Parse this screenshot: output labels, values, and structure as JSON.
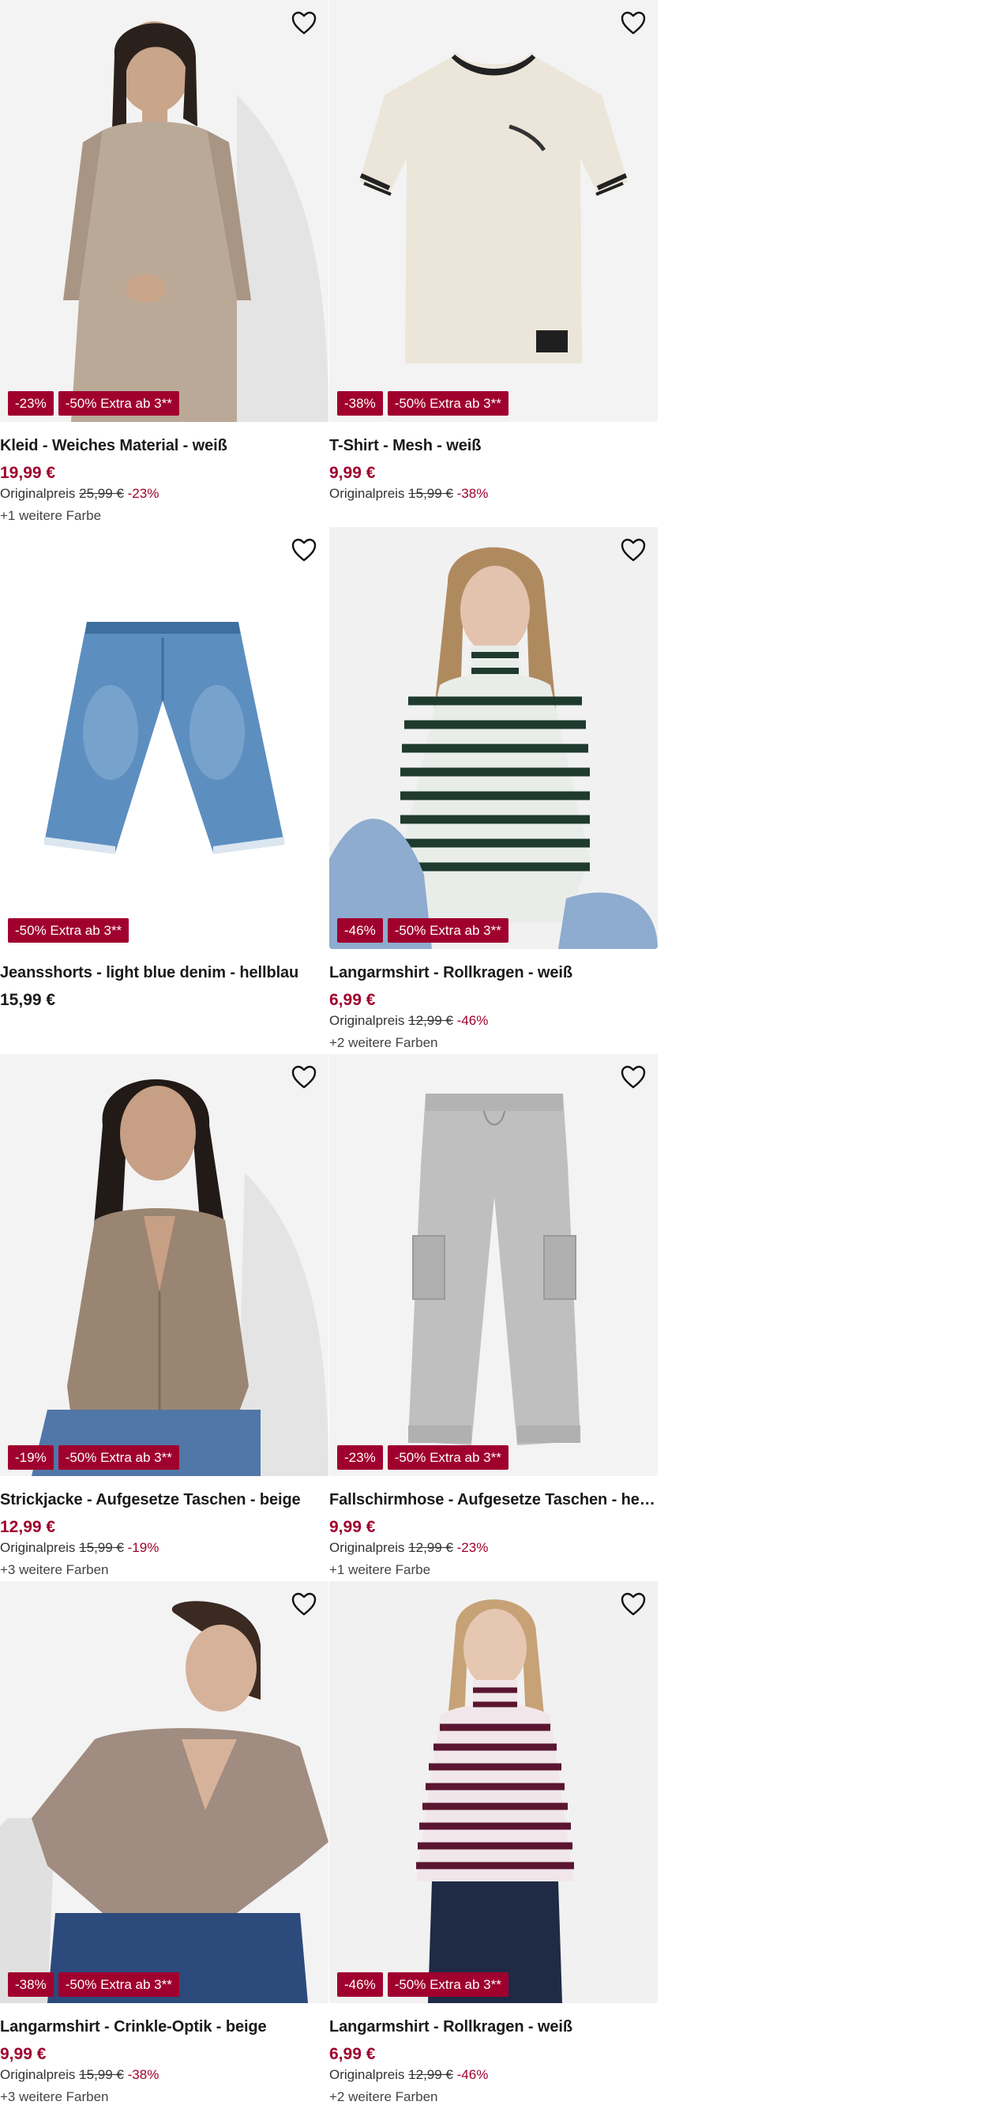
{
  "colors": {
    "accent": "#a0002e",
    "image_bg": "#f2f2f2",
    "text": "#1a1a1a"
  },
  "products": [
    {
      "title": "Kleid - Weiches Material - weiß",
      "price": "19,99 €",
      "on_sale": true,
      "orig_label": "Originalpreis",
      "orig_price": "25,99 €",
      "orig_pct": "-23%",
      "colors": "+1 weitere Farbe",
      "badges": [
        "-23%",
        "-50% Extra ab 3**"
      ],
      "image": "dress-model",
      "favorite_icon": "heart-outline-icon"
    },
    {
      "title": "T-Shirt - Mesh - weiß",
      "price": "9,99 €",
      "on_sale": true,
      "orig_label": "Originalpreis",
      "orig_price": "15,99 €",
      "orig_pct": "-38%",
      "colors": "",
      "badges": [
        "-38%",
        "-50% Extra ab 3**"
      ],
      "image": "tshirt",
      "favorite_icon": "heart-outline-icon"
    },
    {
      "title": "Jeansshorts - light blue denim - hellblau",
      "price": "15,99 €",
      "on_sale": false,
      "orig_label": "",
      "orig_price": "",
      "orig_pct": "",
      "colors": "",
      "badges": [
        "-50% Extra ab 3**"
      ],
      "image": "denim-shorts",
      "favorite_icon": "heart-outline-icon"
    },
    {
      "title": "Langarmshirt - Rollkragen - weiß",
      "price": "6,99 €",
      "on_sale": true,
      "orig_label": "Originalpreis",
      "orig_price": "12,99 €",
      "orig_pct": "-46%",
      "colors": "+2 weitere Farben",
      "badges": [
        "-46%",
        "-50% Extra ab 3**"
      ],
      "image": "striped-turtleneck-green",
      "favorite_icon": "heart-outline-icon"
    },
    {
      "title": "Strickjacke - Aufgesetze Taschen - beige",
      "price": "12,99 €",
      "on_sale": true,
      "orig_label": "Originalpreis",
      "orig_price": "15,99 €",
      "orig_pct": "-19%",
      "colors": "+3 weitere Farben",
      "badges": [
        "-19%",
        "-50% Extra ab 3**"
      ],
      "image": "cardigan-model",
      "favorite_icon": "heart-outline-icon"
    },
    {
      "title": "Fallschirmhose - Aufgesetze Taschen - hellg...",
      "price": "9,99 €",
      "on_sale": true,
      "orig_label": "Originalpreis",
      "orig_price": "12,99 €",
      "orig_pct": "-23%",
      "colors": "+1 weitere Farbe",
      "badges": [
        "-23%",
        "-50% Extra ab 3**"
      ],
      "image": "grey-cargo-pants",
      "favorite_icon": "heart-outline-icon"
    },
    {
      "title": "Langarmshirt - Crinkle-Optik - beige",
      "price": "9,99 €",
      "on_sale": true,
      "orig_label": "Originalpreis",
      "orig_price": "15,99 €",
      "orig_pct": "-38%",
      "colors": "+3 weitere Farben",
      "badges": [
        "-38%",
        "-50% Extra ab 3**"
      ],
      "image": "crinkle-shirt-model",
      "favorite_icon": "heart-outline-icon"
    },
    {
      "title": "Langarmshirt - Rollkragen - weiß",
      "price": "6,99 €",
      "on_sale": true,
      "orig_label": "Originalpreis",
      "orig_price": "12,99 €",
      "orig_pct": "-46%",
      "colors": "+2 weitere Farben",
      "badges": [
        "-46%",
        "-50% Extra ab 3**"
      ],
      "image": "striped-turtleneck-burgundy",
      "favorite_icon": "heart-outline-icon"
    }
  ]
}
